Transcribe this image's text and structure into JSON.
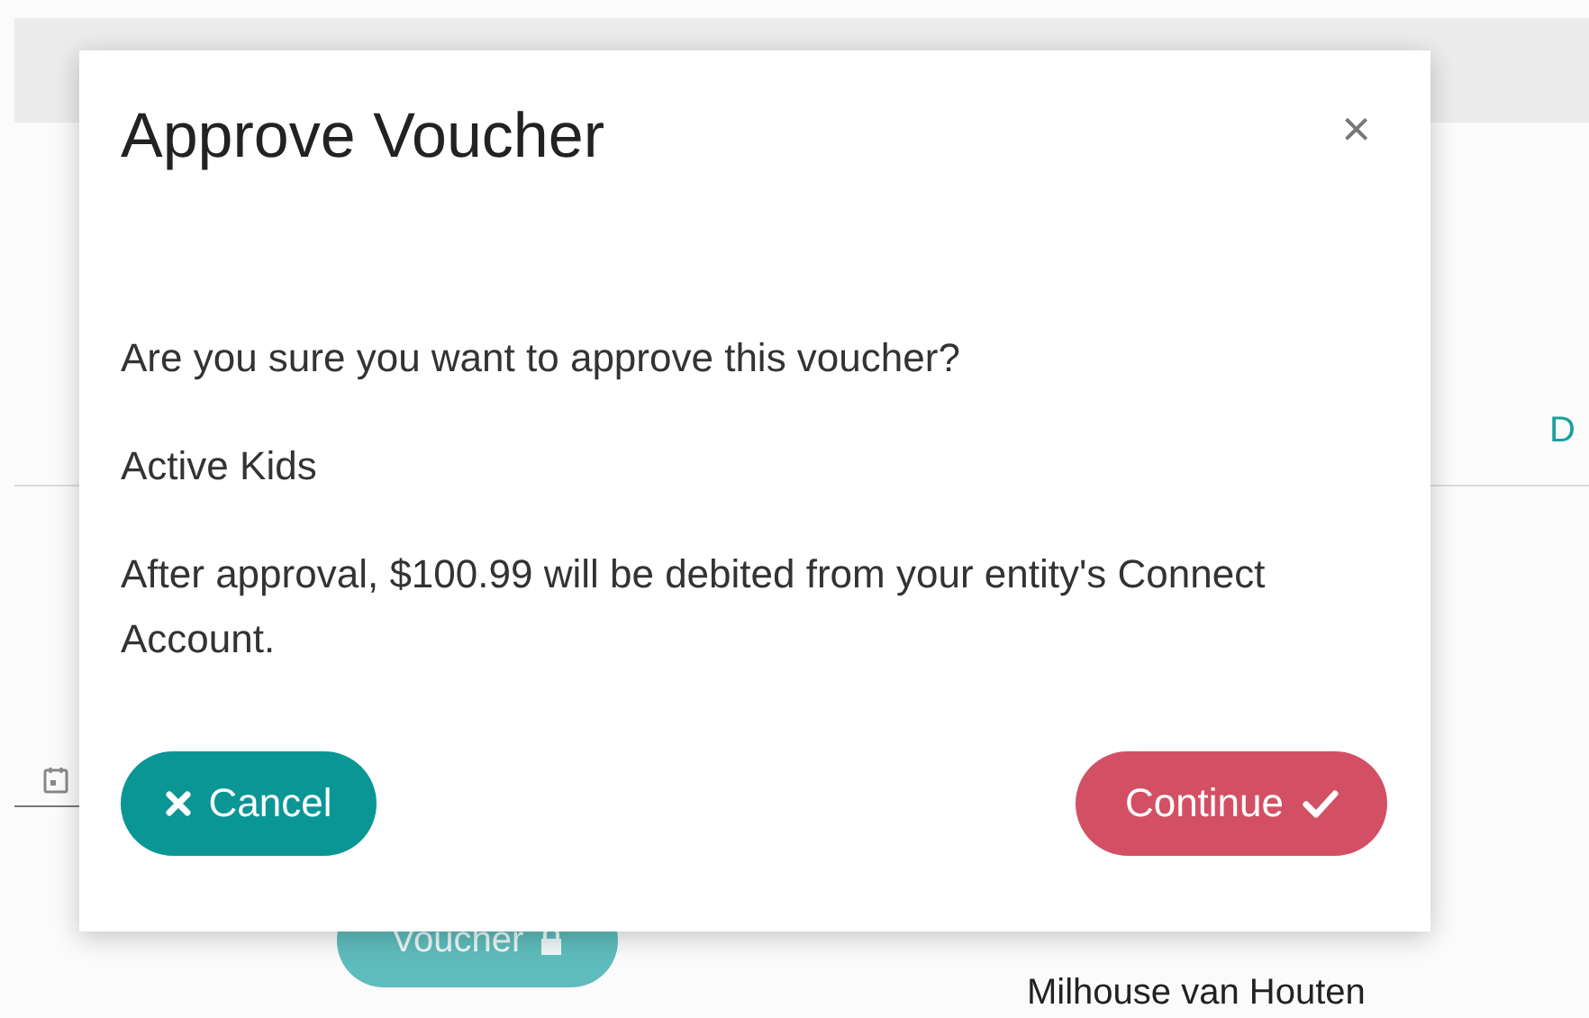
{
  "background": {
    "tab_label": "D",
    "voucher_button": "Voucher",
    "participant_name": "Milhouse van Houten"
  },
  "dialog": {
    "title": "Approve Voucher",
    "close": "×",
    "message": "Are you sure you want to approve this voucher?",
    "program": "Active Kids",
    "note": "After approval, $100.99 will be debited from your entity's Connect Account.",
    "buttons": [
      {
        "label": "Cancel",
        "kind": "cancel"
      },
      {
        "label": "Continue",
        "kind": "confirm"
      }
    ]
  }
}
